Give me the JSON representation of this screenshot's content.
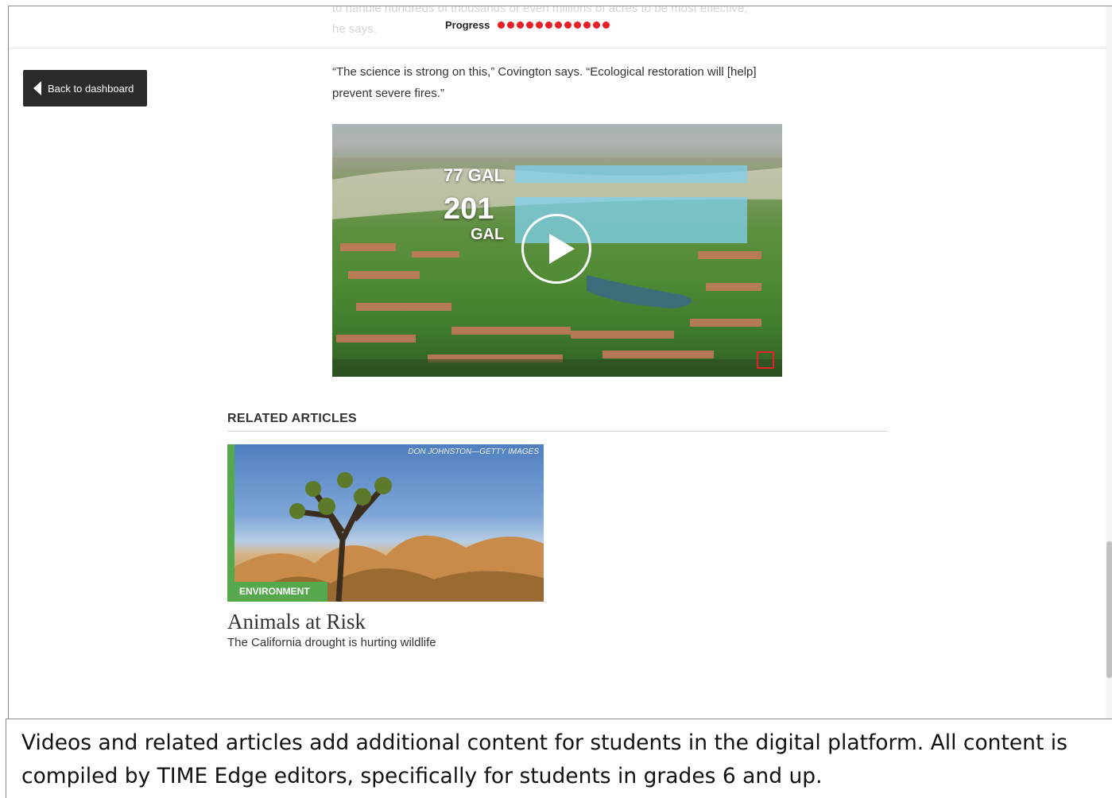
{
  "header": {
    "faded_line_1": "to handle hundreds of thousands or even millions of acres to be most effective,",
    "faded_line_2": "he says.",
    "progress_label": "Progress",
    "progress_dots": 12
  },
  "nav": {
    "back_label": "Back to dashboard"
  },
  "article": {
    "quote": "“The science is strong on this,” Covington says. “Ecological restoration will [help] prevent severe fires.”"
  },
  "video": {
    "label_top": "77 GAL",
    "label_mid_number": "201",
    "label_mid_unit": "GAL",
    "icons": [
      "play-icon",
      "time-logo-icon"
    ]
  },
  "related": {
    "heading": "RELATED ARTICLES",
    "card": {
      "credit": "DON JOHNSTON—GETTY IMAGES",
      "tag": "ENVIRONMENT",
      "title": "Animals at Risk",
      "subtitle": "The California drought is hurting wildlife"
    }
  },
  "caption": {
    "line_1": "Videos and related articles add additional content for students in the digital platform. All content is",
    "line_2": "compiled by TIME Edge editors, specifically for students in grades 6 and up."
  },
  "colors": {
    "accent_red": "#e8202a",
    "tag_green": "#55a84b",
    "button_dark": "#2b2b2b"
  }
}
